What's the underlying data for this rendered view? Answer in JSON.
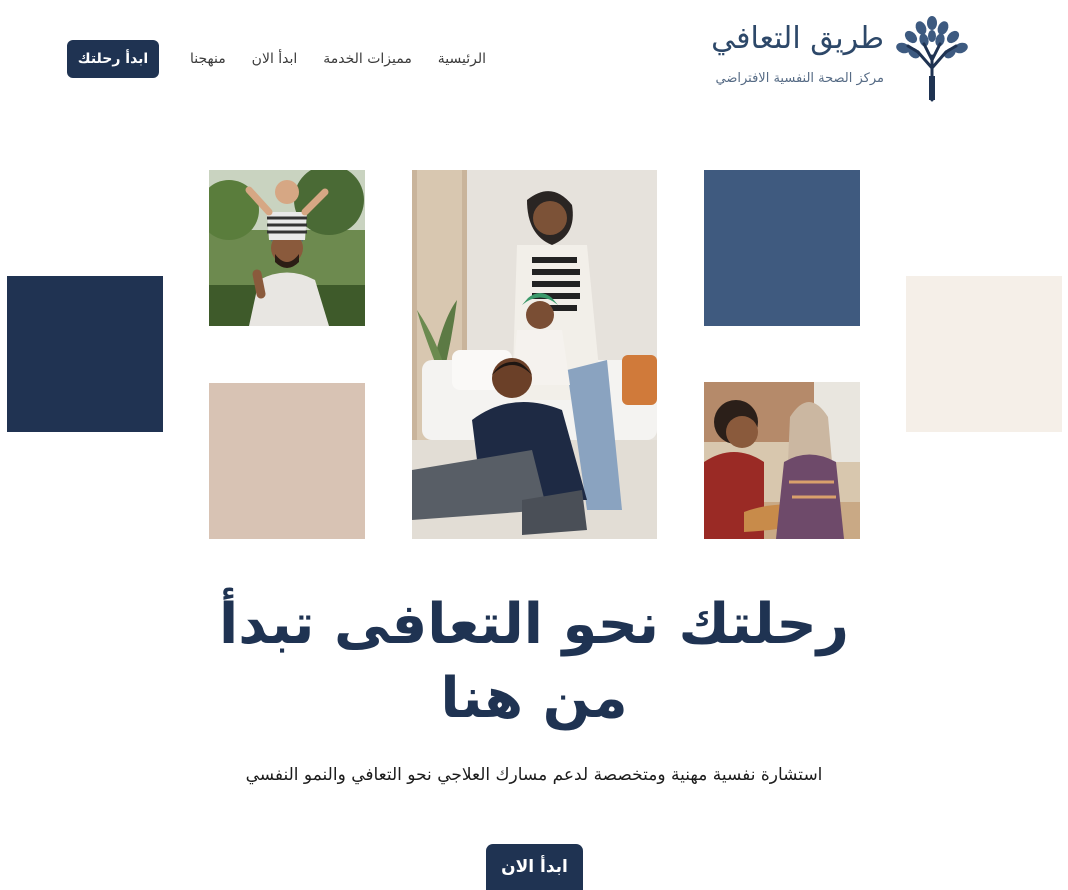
{
  "brand": {
    "title": "طريق التعافي",
    "subtitle": "مركز الصحة النفسية الافتراضي",
    "logo_icon": "tree-icon"
  },
  "nav": {
    "items": [
      "الرئيسية",
      "مميزات الخدمة",
      "ابدأ الان",
      "منهجنا"
    ]
  },
  "header": {
    "cta_label": "ابدأ رحلتك"
  },
  "hero": {
    "headline": "رحلتك نحو التعافى تبدأ من هنا",
    "subtext": "استشارة نفسية مهنية ومتخصصة لدعم مسارك العلاجي نحو التعافي والنمو النفسي",
    "cta_label": "ابدأ الان"
  },
  "colors": {
    "navy": "#1f3352",
    "blue": "#3f5a7f",
    "beige": "#d8c3b4",
    "cream": "#f5efe8"
  }
}
